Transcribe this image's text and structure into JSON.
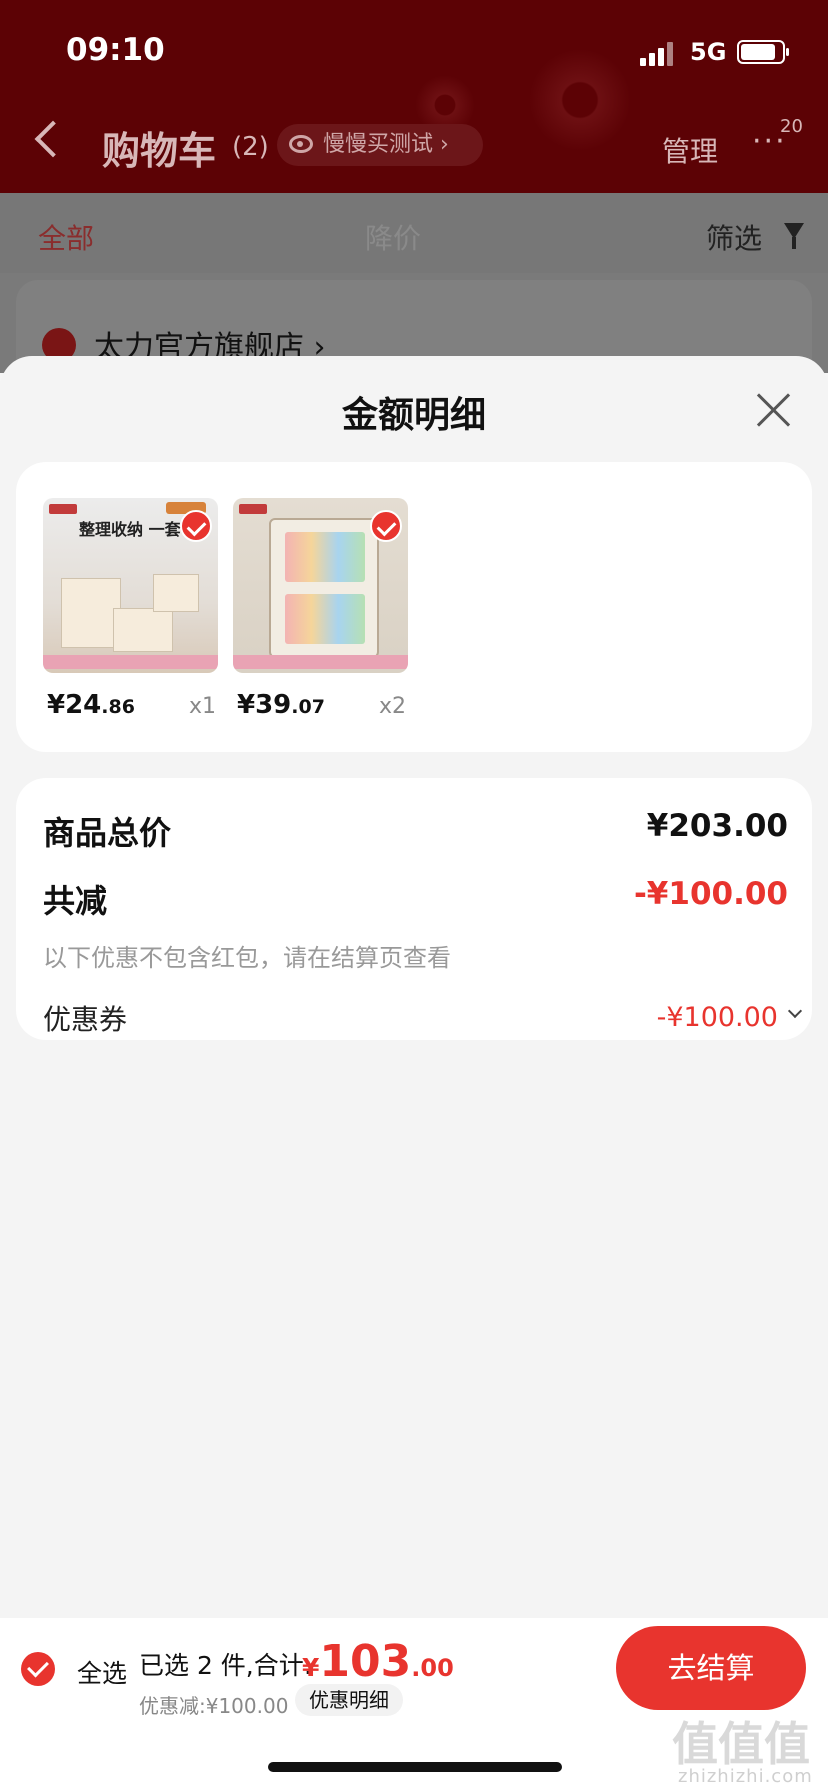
{
  "status_bar": {
    "time": "09:10",
    "network": "5G"
  },
  "header": {
    "title": "购物车",
    "count": "(2)",
    "pill": "慢慢买测试",
    "manage": "管理",
    "more": "···",
    "badge": "20"
  },
  "tabs": {
    "all": "全部",
    "price_drop": "降价",
    "filter": "筛选"
  },
  "shop": {
    "name": "太力官方旗舰店 ›"
  },
  "sheet": {
    "title": "金额明细",
    "products": [
      {
        "image_text": "整理收纳 一套",
        "price_int": "¥24",
        "price_dec": ".86",
        "qty": "x1"
      },
      {
        "image_text": "",
        "price_int": "¥39",
        "price_dec": ".07",
        "qty": "x2"
      }
    ],
    "summary": {
      "total_label": "商品总价",
      "total_value": "¥203.00",
      "reduce_label": "共减",
      "reduce_value": "-¥100.00",
      "note": "以下优惠不包含红包，请在结算页查看",
      "coupon_label": "优惠券",
      "coupon_value": "-¥100.00"
    }
  },
  "bottom_bar": {
    "select_all": "全选",
    "selected_text": "已选 2 件,合计:",
    "total_symbol": "¥",
    "total_int": "103",
    "total_dec": ".00",
    "discount": "优惠减:¥100.00",
    "detail": "优惠明细",
    "checkout": "去结算"
  },
  "watermark": {
    "glyphs": "值值值",
    "url": "zhizhizhi.com"
  },
  "colors": {
    "accent": "#e8342e",
    "header_bg": "#5c0205"
  }
}
